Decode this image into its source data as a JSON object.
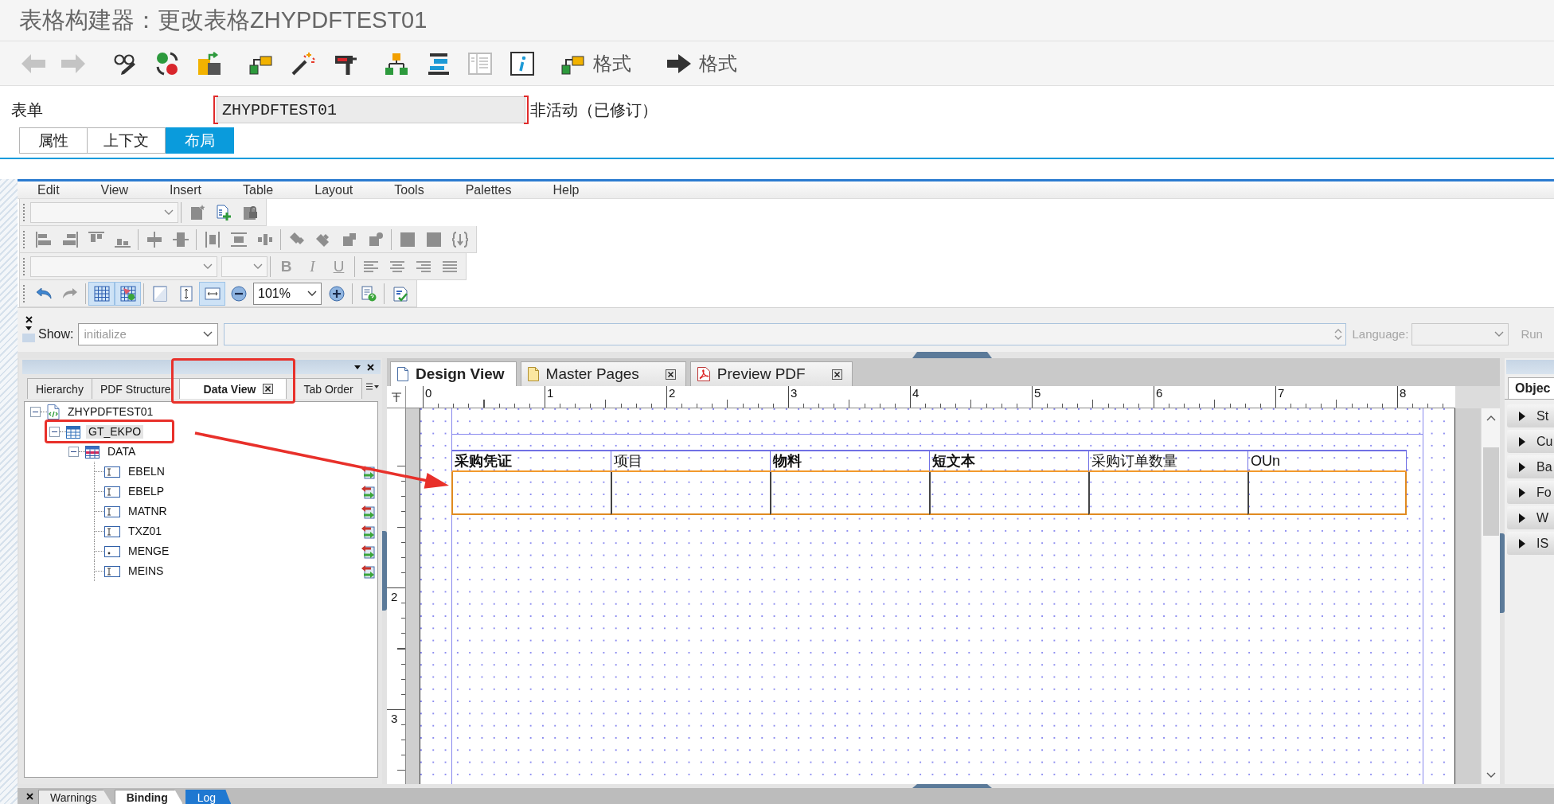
{
  "window": {
    "title": "表格构建器：更改表格ZHYPDFTEST01"
  },
  "toolbar": {
    "back_disabled": true,
    "forward_disabled": true,
    "format_buttons": [
      {
        "kind": "linked",
        "label": "格式"
      },
      {
        "kind": "arrow",
        "label": "格式"
      }
    ]
  },
  "form": {
    "label": "表单",
    "value": "ZHYPDFTEST01",
    "status": "非活动（已修订）"
  },
  "tabs": [
    {
      "label": "属性",
      "selected": false
    },
    {
      "label": "上下文",
      "selected": false
    },
    {
      "label": "布局",
      "selected": true
    }
  ],
  "designer": {
    "menu": [
      "Edit",
      "View",
      "Insert",
      "Table",
      "Layout",
      "Tools",
      "Palettes",
      "Help"
    ],
    "toolbars": {
      "objects_disabled": true,
      "format_disabled": true,
      "format_buttons": [
        {
          "kind": "bold",
          "label": "B"
        },
        {
          "kind": "italic",
          "label": "I"
        },
        {
          "kind": "underline",
          "label": "U"
        }
      ],
      "grid_on": true,
      "snap_on": true,
      "fit_height_on": false,
      "fit_width_on": true,
      "zoom": "101%"
    },
    "show": {
      "label": "Show:",
      "value": "initialize",
      "disabled": true,
      "language_label": "Language:",
      "run_label": "Run"
    },
    "data_panel": {
      "tabs": [
        {
          "label": "Hierarchy",
          "selected": false,
          "closable": false
        },
        {
          "label": "PDF Structure",
          "selected": false,
          "closable": false
        },
        {
          "label": "Data View",
          "selected": true,
          "closable": true
        },
        {
          "label": "Tab Order",
          "selected": false,
          "closable": false
        }
      ],
      "tree": [
        {
          "label": "ZHYPDFTEST01",
          "kind": "interface",
          "expanded": true,
          "selected": false,
          "children": [
            {
              "label": "GT_EKPO",
              "kind": "table",
              "expanded": true,
              "selected": true,
              "children": [
                {
                  "label": "DATA",
                  "kind": "structure",
                  "expanded": true,
                  "selected": false,
                  "children": [
                    {
                      "label": "EBELN",
                      "kind": "text",
                      "selected": false,
                      "bound": true
                    },
                    {
                      "label": "EBELP",
                      "kind": "text",
                      "selected": false,
                      "bound": true
                    },
                    {
                      "label": "MATNR",
                      "kind": "text",
                      "selected": false,
                      "bound": true
                    },
                    {
                      "label": "TXZ01",
                      "kind": "text",
                      "selected": false,
                      "bound": true
                    },
                    {
                      "label": "MENGE",
                      "kind": "number",
                      "selected": false,
                      "bound": true
                    },
                    {
                      "label": "MEINS",
                      "kind": "text",
                      "selected": false,
                      "bound": true
                    }
                  ]
                }
              ]
            }
          ]
        }
      ]
    },
    "design_tabs": [
      {
        "label": "Design View",
        "kind": "design",
        "selected": true,
        "closable": false
      },
      {
        "label": "Master Pages",
        "kind": "pages",
        "selected": false,
        "closable": true
      },
      {
        "label": "Preview PDF",
        "kind": "pdf",
        "selected": false,
        "closable": true
      }
    ],
    "ruler": {
      "x_labels": [
        "0",
        "1",
        "2",
        "3",
        "4",
        "5",
        "6",
        "7",
        "8"
      ],
      "y_labels": [
        "2",
        "3"
      ]
    },
    "table": {
      "columns": [
        {
          "label": "采购凭证",
          "bold": true
        },
        {
          "label": "项目",
          "bold": false
        },
        {
          "label": "物料",
          "bold": true
        },
        {
          "label": "短文本",
          "bold": true
        },
        {
          "label": "采购订单数量",
          "bold": false
        },
        {
          "label": "OUn",
          "bold": false
        }
      ]
    },
    "object_panel": {
      "tab": "Objec",
      "items": [
        {
          "label": "St",
          "expanded": false
        },
        {
          "label": "Cu",
          "expanded": false
        },
        {
          "label": "Ba",
          "expanded": false
        },
        {
          "label": "Fo",
          "expanded": false
        },
        {
          "label": "W",
          "expanded": false
        },
        {
          "label": "IS",
          "expanded": false
        }
      ]
    },
    "bottom_tabs": [
      {
        "label": "Warnings",
        "selected": false,
        "highlighted": false
      },
      {
        "label": "Binding",
        "selected": true,
        "highlighted": false
      },
      {
        "label": "Log",
        "selected": false,
        "highlighted": true
      }
    ]
  }
}
